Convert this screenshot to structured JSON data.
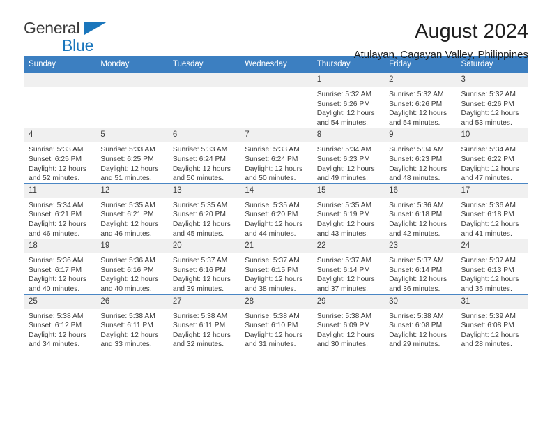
{
  "brand": {
    "name_top": "General",
    "name_bottom": "Blue",
    "triangle_color": "#1a76bc",
    "text_color": "#3b3b3b"
  },
  "header": {
    "title": "August 2024",
    "subtitle": "Atulayan, Cagayan Valley, Philippines"
  },
  "theme": {
    "header_bg": "#3c7fc1",
    "header_text": "#ffffff",
    "daynum_bg": "#f0f0f0",
    "body_text": "#3b3b3b"
  },
  "weekdays": [
    "Sunday",
    "Monday",
    "Tuesday",
    "Wednesday",
    "Thursday",
    "Friday",
    "Saturday"
  ],
  "labels": {
    "sunrise": "Sunrise:",
    "sunset": "Sunset:",
    "daylight": "Daylight:"
  },
  "weeks": [
    [
      {
        "day": "",
        "sunrise": "",
        "sunset": "",
        "daylight": ""
      },
      {
        "day": "",
        "sunrise": "",
        "sunset": "",
        "daylight": ""
      },
      {
        "day": "",
        "sunrise": "",
        "sunset": "",
        "daylight": ""
      },
      {
        "day": "",
        "sunrise": "",
        "sunset": "",
        "daylight": ""
      },
      {
        "day": "1",
        "sunrise": "Sunrise: 5:32 AM",
        "sunset": "Sunset: 6:26 PM",
        "daylight": "Daylight: 12 hours and 54 minutes."
      },
      {
        "day": "2",
        "sunrise": "Sunrise: 5:32 AM",
        "sunset": "Sunset: 6:26 PM",
        "daylight": "Daylight: 12 hours and 54 minutes."
      },
      {
        "day": "3",
        "sunrise": "Sunrise: 5:32 AM",
        "sunset": "Sunset: 6:26 PM",
        "daylight": "Daylight: 12 hours and 53 minutes."
      }
    ],
    [
      {
        "day": "4",
        "sunrise": "Sunrise: 5:33 AM",
        "sunset": "Sunset: 6:25 PM",
        "daylight": "Daylight: 12 hours and 52 minutes."
      },
      {
        "day": "5",
        "sunrise": "Sunrise: 5:33 AM",
        "sunset": "Sunset: 6:25 PM",
        "daylight": "Daylight: 12 hours and 51 minutes."
      },
      {
        "day": "6",
        "sunrise": "Sunrise: 5:33 AM",
        "sunset": "Sunset: 6:24 PM",
        "daylight": "Daylight: 12 hours and 50 minutes."
      },
      {
        "day": "7",
        "sunrise": "Sunrise: 5:33 AM",
        "sunset": "Sunset: 6:24 PM",
        "daylight": "Daylight: 12 hours and 50 minutes."
      },
      {
        "day": "8",
        "sunrise": "Sunrise: 5:34 AM",
        "sunset": "Sunset: 6:23 PM",
        "daylight": "Daylight: 12 hours and 49 minutes."
      },
      {
        "day": "9",
        "sunrise": "Sunrise: 5:34 AM",
        "sunset": "Sunset: 6:23 PM",
        "daylight": "Daylight: 12 hours and 48 minutes."
      },
      {
        "day": "10",
        "sunrise": "Sunrise: 5:34 AM",
        "sunset": "Sunset: 6:22 PM",
        "daylight": "Daylight: 12 hours and 47 minutes."
      }
    ],
    [
      {
        "day": "11",
        "sunrise": "Sunrise: 5:34 AM",
        "sunset": "Sunset: 6:21 PM",
        "daylight": "Daylight: 12 hours and 46 minutes."
      },
      {
        "day": "12",
        "sunrise": "Sunrise: 5:35 AM",
        "sunset": "Sunset: 6:21 PM",
        "daylight": "Daylight: 12 hours and 46 minutes."
      },
      {
        "day": "13",
        "sunrise": "Sunrise: 5:35 AM",
        "sunset": "Sunset: 6:20 PM",
        "daylight": "Daylight: 12 hours and 45 minutes."
      },
      {
        "day": "14",
        "sunrise": "Sunrise: 5:35 AM",
        "sunset": "Sunset: 6:20 PM",
        "daylight": "Daylight: 12 hours and 44 minutes."
      },
      {
        "day": "15",
        "sunrise": "Sunrise: 5:35 AM",
        "sunset": "Sunset: 6:19 PM",
        "daylight": "Daylight: 12 hours and 43 minutes."
      },
      {
        "day": "16",
        "sunrise": "Sunrise: 5:36 AM",
        "sunset": "Sunset: 6:18 PM",
        "daylight": "Daylight: 12 hours and 42 minutes."
      },
      {
        "day": "17",
        "sunrise": "Sunrise: 5:36 AM",
        "sunset": "Sunset: 6:18 PM",
        "daylight": "Daylight: 12 hours and 41 minutes."
      }
    ],
    [
      {
        "day": "18",
        "sunrise": "Sunrise: 5:36 AM",
        "sunset": "Sunset: 6:17 PM",
        "daylight": "Daylight: 12 hours and 40 minutes."
      },
      {
        "day": "19",
        "sunrise": "Sunrise: 5:36 AM",
        "sunset": "Sunset: 6:16 PM",
        "daylight": "Daylight: 12 hours and 40 minutes."
      },
      {
        "day": "20",
        "sunrise": "Sunrise: 5:37 AM",
        "sunset": "Sunset: 6:16 PM",
        "daylight": "Daylight: 12 hours and 39 minutes."
      },
      {
        "day": "21",
        "sunrise": "Sunrise: 5:37 AM",
        "sunset": "Sunset: 6:15 PM",
        "daylight": "Daylight: 12 hours and 38 minutes."
      },
      {
        "day": "22",
        "sunrise": "Sunrise: 5:37 AM",
        "sunset": "Sunset: 6:14 PM",
        "daylight": "Daylight: 12 hours and 37 minutes."
      },
      {
        "day": "23",
        "sunrise": "Sunrise: 5:37 AM",
        "sunset": "Sunset: 6:14 PM",
        "daylight": "Daylight: 12 hours and 36 minutes."
      },
      {
        "day": "24",
        "sunrise": "Sunrise: 5:37 AM",
        "sunset": "Sunset: 6:13 PM",
        "daylight": "Daylight: 12 hours and 35 minutes."
      }
    ],
    [
      {
        "day": "25",
        "sunrise": "Sunrise: 5:38 AM",
        "sunset": "Sunset: 6:12 PM",
        "daylight": "Daylight: 12 hours and 34 minutes."
      },
      {
        "day": "26",
        "sunrise": "Sunrise: 5:38 AM",
        "sunset": "Sunset: 6:11 PM",
        "daylight": "Daylight: 12 hours and 33 minutes."
      },
      {
        "day": "27",
        "sunrise": "Sunrise: 5:38 AM",
        "sunset": "Sunset: 6:11 PM",
        "daylight": "Daylight: 12 hours and 32 minutes."
      },
      {
        "day": "28",
        "sunrise": "Sunrise: 5:38 AM",
        "sunset": "Sunset: 6:10 PM",
        "daylight": "Daylight: 12 hours and 31 minutes."
      },
      {
        "day": "29",
        "sunrise": "Sunrise: 5:38 AM",
        "sunset": "Sunset: 6:09 PM",
        "daylight": "Daylight: 12 hours and 30 minutes."
      },
      {
        "day": "30",
        "sunrise": "Sunrise: 5:38 AM",
        "sunset": "Sunset: 6:08 PM",
        "daylight": "Daylight: 12 hours and 29 minutes."
      },
      {
        "day": "31",
        "sunrise": "Sunrise: 5:39 AM",
        "sunset": "Sunset: 6:08 PM",
        "daylight": "Daylight: 12 hours and 28 minutes."
      }
    ]
  ]
}
